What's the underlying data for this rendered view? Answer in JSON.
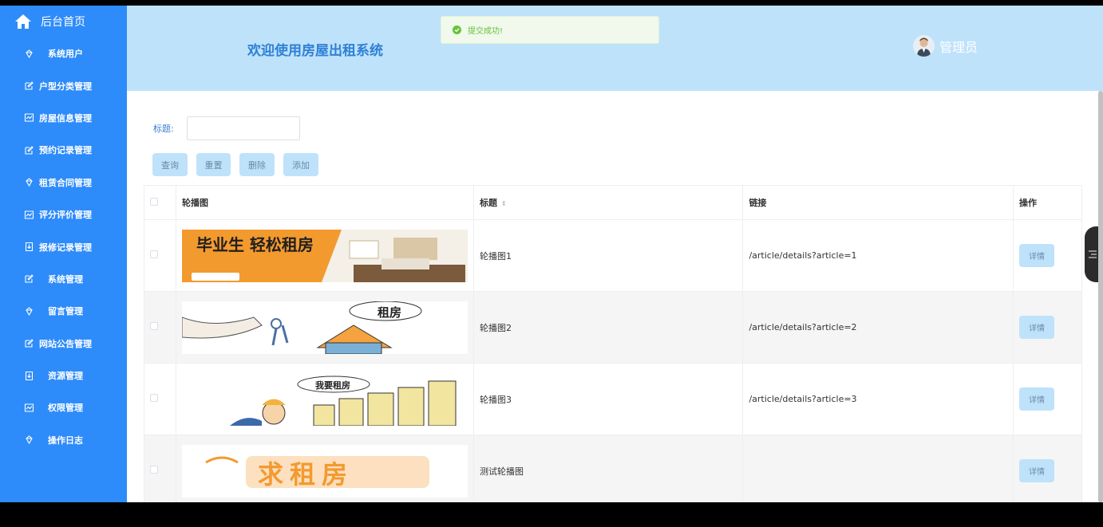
{
  "sidebar": {
    "home": "后台首页",
    "items": [
      {
        "label": "系统用户",
        "icon": "diamond-icon"
      },
      {
        "label": "户型分类管理",
        "icon": "edit-icon"
      },
      {
        "label": "房屋信息管理",
        "icon": "chart-icon"
      },
      {
        "label": "预约记录管理",
        "icon": "edit-icon"
      },
      {
        "label": "租赁合同管理",
        "icon": "diamond-icon"
      },
      {
        "label": "评分评价管理",
        "icon": "chart-icon"
      },
      {
        "label": "报修记录管理",
        "icon": "download-icon"
      },
      {
        "label": "系统管理",
        "icon": "edit-icon"
      },
      {
        "label": "留言管理",
        "icon": "diamond-icon"
      },
      {
        "label": "网站公告管理",
        "icon": "edit-icon"
      },
      {
        "label": "资源管理",
        "icon": "download-icon"
      },
      {
        "label": "权限管理",
        "icon": "chart-icon"
      },
      {
        "label": "操作日志",
        "icon": "diamond-icon"
      }
    ]
  },
  "header": {
    "welcome": "欢迎使用房屋出租系统",
    "user": "管理员"
  },
  "toast": {
    "message": "提交成功!"
  },
  "search": {
    "label": "标题:",
    "value": "",
    "placeholder": ""
  },
  "buttons": {
    "query": "查询",
    "reset": "重置",
    "delete": "删除",
    "add": "添加"
  },
  "table": {
    "headers": {
      "image": "轮播图",
      "title": "标题",
      "link": "链接",
      "action": "操作"
    },
    "rows": [
      {
        "title": "轮播图1",
        "link": "/article/details?article=1",
        "action": "详情",
        "banner_text": "毕业生 轻松租房"
      },
      {
        "title": "轮播图2",
        "link": "/article/details?article=2",
        "action": "详情",
        "banner_text": "租房"
      },
      {
        "title": "轮播图3",
        "link": "/article/details?article=3",
        "action": "详情",
        "banner_text": "我要租房"
      },
      {
        "title": "测试轮播图",
        "link": "",
        "action": "详情",
        "banner_text": "求租房"
      }
    ]
  },
  "colors": {
    "sidebar": "#2e8bfa",
    "header": "#bfe2fb",
    "button": "#bfe2fb",
    "toast_success": "#67c23a"
  }
}
